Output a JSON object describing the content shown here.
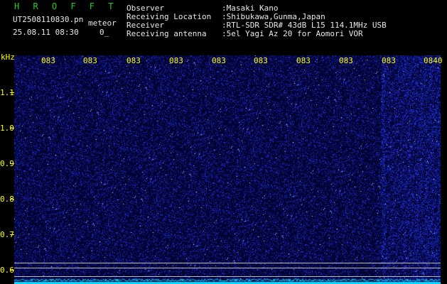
{
  "header": {
    "app_title": "H R O F F T",
    "filename": "UT2508110830.pn",
    "meteor_label": "meteor",
    "date_time": "25.08.11 08:30",
    "count": "0_"
  },
  "info": [
    {
      "label": "Observer",
      "value": ":Masaki Kano"
    },
    {
      "label": "Receiving Location",
      "value": ":Shibukawa,Gunma,Japan"
    },
    {
      "label": "Receiver",
      "value": ":RTL-SDR SDR# 43dB L15 114.1MHz USB"
    },
    {
      "label": "Receiving antenna",
      "value": ":5el Yagi Az 20 for Aomori VOR"
    }
  ],
  "y_axis": {
    "unit": "kHz",
    "ticks": [
      "1.1",
      "1.0",
      "0.9",
      "0.8",
      "0.7",
      "0.6"
    ]
  },
  "time_labels": [
    "083",
    "083",
    "083",
    "083",
    "083",
    "083",
    "083",
    "083",
    "083",
    "0840"
  ],
  "colors": {
    "title_green": "#22cc22",
    "label_yellow": "#ffff00",
    "noise_blue": "#1f2fd6",
    "baseline_cyan": "#00d8ff"
  }
}
